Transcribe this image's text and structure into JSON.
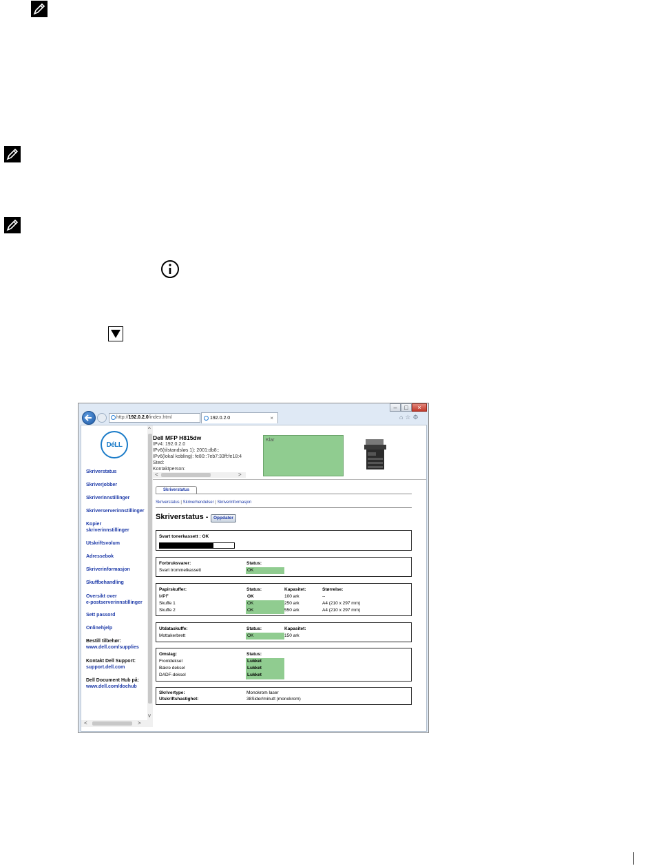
{
  "address_url_prefix": "http://",
  "address_url_host": "192.0.2.0",
  "address_url_path": "/index.html",
  "address_tools": "⌕ ▾ ↻",
  "tab_title": "192.0.2.0",
  "tab_close": "×",
  "toolbar_icons": "⌂☆⚙",
  "window_controls": {
    "min": "–",
    "max": "□",
    "close": "×"
  },
  "logo_text": "DéLL",
  "left_menu": [
    "Skriverstatus",
    "Skriverjobber",
    "Skriverinnstillinger",
    "Skriverserverinnstillinger",
    "Kopier",
    "skriverinnstillinger",
    "Utskriftsvolum",
    "Adressebok",
    "Skriverinformasjon",
    "Skuffbehandling",
    "Oversikt over",
    "e-postserverinnstillinger",
    "Sett passord",
    "Onlinehjelp"
  ],
  "left_links": [
    {
      "label": "Bestill tilbehør:",
      "url": "www.dell.com/supplies"
    },
    {
      "label": "Kontakt Dell Support:",
      "url": "support.dell.com"
    },
    {
      "label": "Dell Document Hub på:",
      "url": "www.dell.com/dochub"
    }
  ],
  "device": {
    "name": "Dell MFP H815dw",
    "ipv4": "IPv4: 192.0.2.0",
    "ipv6_stateless": "IPv6(tilstandsløs 1): 2001:db8::",
    "ipv6_link": "IPv6(lokal kobling): fe80::7eb7:33ff:fe18:4",
    "location": "Sted:",
    "contact": "Kontaktperson:",
    "status": "Klar"
  },
  "main": {
    "tab": "Skriverstatus",
    "sublinks": [
      "Skriverstatus",
      "Skriverhendelser",
      "Skriverinformasjon"
    ],
    "sublink_sep": "|",
    "title": "Skriverstatus -",
    "refresh": "Oppdater",
    "toner": {
      "label": "Svart tonerkassett : OK",
      "level": 0.72
    },
    "consumables": {
      "headers": [
        "Forbruksvarer:",
        "Status:"
      ],
      "rows": [
        [
          "Svart trommelkassett",
          "OK"
        ]
      ]
    },
    "trays": {
      "headers": [
        "Papirskuffer:",
        "Status:",
        "Kapasitet:",
        "Størrelse:"
      ],
      "rows": [
        [
          "MPF",
          "OK",
          "100 ark",
          "--"
        ],
        [
          "Skuffe 1",
          "OK",
          "250 ark",
          "A4 (210 x 297 mm)"
        ],
        [
          "Skuffe 2",
          "OK",
          "550 ark",
          "A4 (210 x 297 mm)"
        ]
      ]
    },
    "output": {
      "headers": [
        "Utdataskuffe:",
        "Status:",
        "Kapasitet:"
      ],
      "rows": [
        [
          "Mottakerbrett",
          "OK",
          "150 ark"
        ]
      ]
    },
    "covers": {
      "headers": [
        "Omslag:",
        "Status:"
      ],
      "rows": [
        [
          "Frontdeksel",
          "Lukket"
        ],
        [
          "Bakre deksel",
          "Lukket"
        ],
        [
          "DADF-deksel",
          "Lukket"
        ]
      ]
    },
    "info": [
      [
        "Skrivertype:",
        "Monokrom laser"
      ],
      [
        "Utskriftshastighet:",
        "38Sider/minutt (monokrom)"
      ]
    ]
  },
  "scroll_arrows": {
    "left": "<",
    "right": ">",
    "up": "^",
    "down": "v"
  },
  "colors": {
    "ok_green": "#90cc90",
    "link_blue": "#1d3aa8",
    "dell_blue": "#1a7bc8"
  }
}
